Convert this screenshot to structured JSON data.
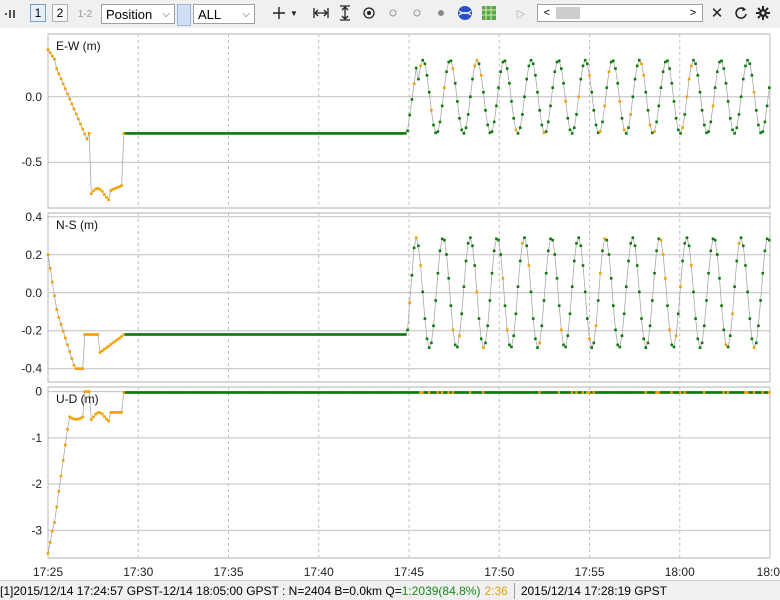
{
  "toolbar": {
    "plot_1": "1",
    "plot_2": "2",
    "plot_12": "1-2",
    "plot_type": "Position",
    "quality_filter": "ALL"
  },
  "colors": {
    "fix": "#0b7a0b",
    "float": "#f5a000",
    "grid": "#c0c0c0",
    "panel_sep": "#909090"
  },
  "chart_data": [
    {
      "type": "scatter",
      "title": "E-W (m)",
      "ylim": [
        -0.85,
        0.48
      ],
      "yticks": [
        "0.0",
        "-0.5"
      ],
      "ytick_values": [
        0.0,
        -0.5
      ],
      "grid": true
    },
    {
      "type": "scatter",
      "title": "N-S (m)",
      "ylim": [
        -0.47,
        0.42
      ],
      "yticks": [
        "0.4",
        "0.2",
        "0.0",
        "-0.2",
        "-0.4"
      ],
      "ytick_values": [
        0.4,
        0.2,
        0.0,
        -0.2,
        -0.4
      ],
      "grid": true
    },
    {
      "type": "scatter",
      "title": "U-D (m)",
      "ylim": [
        -3.6,
        0.1
      ],
      "yticks": [
        "0",
        "-1",
        "-2",
        "-3"
      ],
      "ytick_values": [
        0,
        -1,
        -2,
        -3
      ],
      "grid": true
    }
  ],
  "x_axis": {
    "ticks": [
      "17:25",
      "17:30",
      "17:35",
      "17:40",
      "17:45",
      "17:50",
      "17:55",
      "18:00",
      "18:0"
    ],
    "tick_minutes": [
      0,
      5,
      10,
      15,
      20,
      25,
      30,
      35,
      40
    ],
    "range_minutes": [
      0,
      40
    ]
  },
  "status": {
    "range": "[1]2015/12/14 17:24:57 GPST-12/14 18:05:00 GPST : N=2404 B=0.0km Q=",
    "q_fix": "1:2039(84.8%)",
    "q_float": "2:36",
    "cursor_time": "2015/12/14 17:28:19 GPST"
  }
}
